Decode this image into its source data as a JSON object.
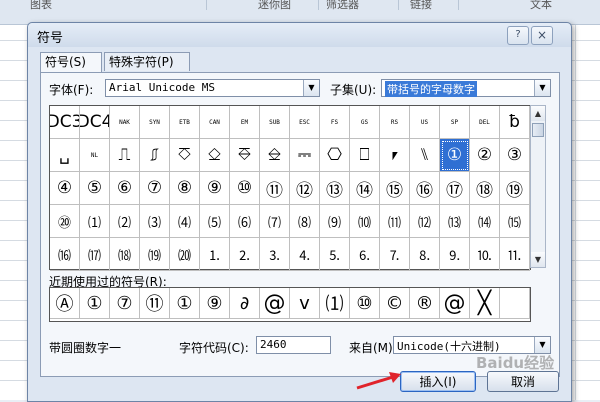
{
  "background": {
    "ribbon_groups": [
      "图表",
      "迷你图",
      "筛选器",
      "链接",
      "文本"
    ]
  },
  "dialog": {
    "title": "符号",
    "help_glyph": "?",
    "close_glyph": "×",
    "tabs": [
      {
        "label": "符号(S)",
        "active": true
      },
      {
        "label": "特殊字符(P)",
        "active": false
      }
    ],
    "font_label": "字体(F):",
    "font_value": "Arial Unicode MS",
    "subset_label": "子集(U):",
    "subset_value": "带括号的字母数字",
    "grid_rows": [
      [
        "DC3",
        "DC4",
        "NAK",
        "SYN",
        "ETB",
        "CAN",
        "EM",
        "SUB",
        "ESC",
        "FS",
        "GS",
        "RS",
        "US",
        "SP",
        "DEL",
        "ƀ"
      ],
      [
        "␣",
        "NL",
        "⎍",
        "⎎",
        "⎏",
        "⎐",
        "⎑",
        "⎒",
        "⎓",
        "⎔",
        "⎕",
        "⎖",
        "⑊",
        "①",
        "②",
        "③"
      ],
      [
        "④",
        "⑤",
        "⑥",
        "⑦",
        "⑧",
        "⑨",
        "⑩",
        "⑪",
        "⑫",
        "⑬",
        "⑭",
        "⑮",
        "⑯",
        "⑰",
        "⑱",
        "⑲"
      ],
      [
        "⑳",
        "⑴",
        "⑵",
        "⑶",
        "⑷",
        "⑸",
        "⑹",
        "⑺",
        "⑻",
        "⑼",
        "⑽",
        "⑾",
        "⑿",
        "⒀",
        "⒁",
        "⒂"
      ],
      [
        "⒃",
        "⒄",
        "⒅",
        "⒆",
        "⒇",
        "⒈",
        "⒉",
        "⒊",
        "⒋",
        "⒌",
        "⒍",
        "⒎",
        "⒏",
        "⒐",
        "⒑",
        "⒒"
      ]
    ],
    "selected_cell": "①",
    "recent_label": "近期使用过的符号(R):",
    "recent_symbols": [
      "Ⓐ",
      "①",
      "⑦",
      "⑪",
      "①",
      "⑨",
      "∂",
      "@",
      "ⅴ",
      "⑴",
      "⑩",
      "©",
      "®",
      "@",
      "╳",
      ""
    ],
    "char_name": "带圆圈数字一",
    "code_label": "字符代码(C):",
    "code_value": "2460",
    "from_label": "来自(M):",
    "from_value": "Unicode(十六进制)",
    "insert_label": "插入(I)",
    "cancel_label": "取消",
    "watermark": "Baidu经验"
  },
  "colors": {
    "selection": "#2f6fd3",
    "arrow": "#e0232b"
  }
}
